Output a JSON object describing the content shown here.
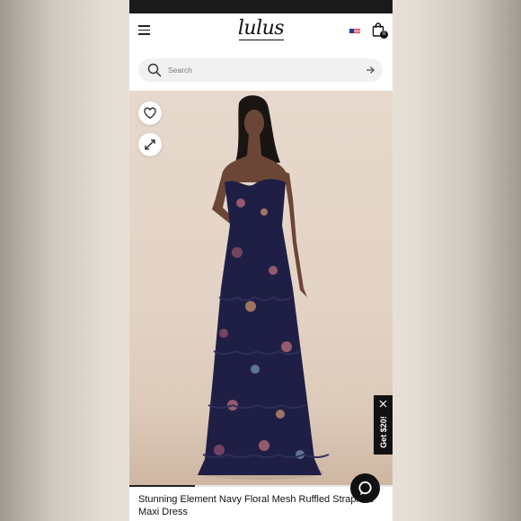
{
  "header": {
    "logo_text": "lulus",
    "cart_count": "0",
    "icons": [
      "hamburger-menu-icon",
      "us-flag-icon",
      "shopping-bag-icon"
    ]
  },
  "search": {
    "placeholder": "Search",
    "icons": [
      "search-icon",
      "arrow-right-icon"
    ]
  },
  "product": {
    "title": "Stunning Element Navy Floral Mesh Ruffled Strapless Maxi Dress",
    "image_progress": 0.25,
    "actions": [
      "heart-icon",
      "expand-icon"
    ]
  },
  "promo": {
    "label": "Get $20!",
    "icons": [
      "close-icon"
    ]
  },
  "chat": {
    "icon": "chat-bubble-icon"
  },
  "colors": {
    "promo_bg": "#111111",
    "dress": "#1f1f45"
  }
}
